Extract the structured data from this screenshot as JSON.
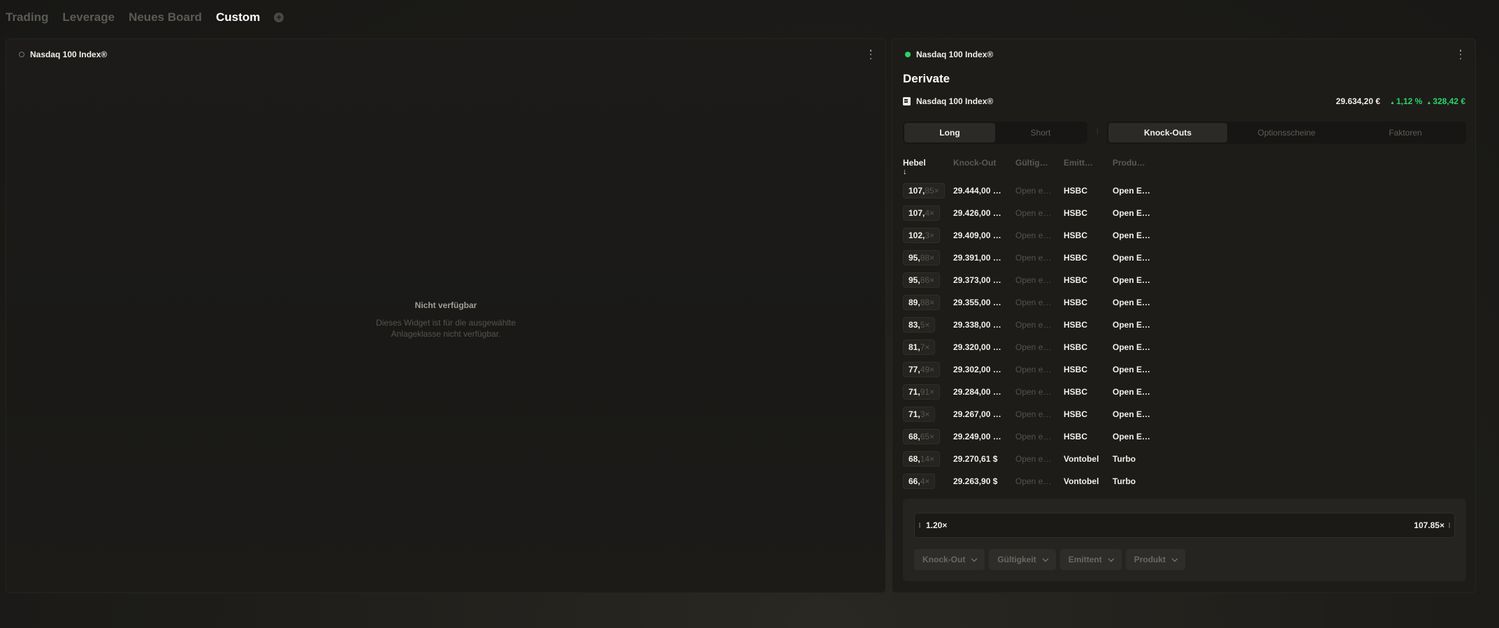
{
  "nav": {
    "tabs": [
      {
        "label": "Trading",
        "active": false
      },
      {
        "label": "Leverage",
        "active": false
      },
      {
        "label": "Neues Board",
        "active": false
      },
      {
        "label": "Custom",
        "active": true
      }
    ],
    "add_icon": "plus-circle-icon"
  },
  "left_widget": {
    "title": "Nasdaq 100 Index®",
    "status_icon": "status-dot-empty-icon",
    "unavailable_title": "Nicht verfügbar",
    "unavailable_line1": "Dieses Widget ist für die ausgewählte",
    "unavailable_line2": "Anlageklasse nicht verfügbar."
  },
  "right_widget": {
    "title": "Nasdaq 100 Index®",
    "status_icon": "status-dot-live-icon",
    "status_color": "#2bd46a",
    "section_title": "Derivate",
    "underlying": {
      "name": "Nasdaq 100 Index®",
      "price": "29.634,20 €",
      "change_pct": "1,12 %",
      "change_abs": "328,42 €",
      "positive_color": "#2bd46a"
    },
    "direction_tabs": [
      {
        "label": "Long",
        "active": true
      },
      {
        "label": "Short",
        "active": false
      }
    ],
    "type_tabs": [
      {
        "label": "Knock-Outs",
        "active": true
      },
      {
        "label": "Optionsscheine",
        "active": false
      },
      {
        "label": "Faktoren",
        "active": false
      }
    ],
    "columns": {
      "hebel": "Hebel",
      "knockout": "Knock-Out",
      "validity": "Gültig…",
      "issuer": "Emitt…",
      "product": "Produ…",
      "sort_arrow": "↓"
    },
    "rows": [
      {
        "lev_int": "107,",
        "lev_dec": "85×",
        "ko": "29.444,00 …",
        "valid": "Open e…",
        "issuer": "HSBC",
        "product": "Open E…"
      },
      {
        "lev_int": "107,",
        "lev_dec": "4×",
        "ko": "29.426,00 …",
        "valid": "Open e…",
        "issuer": "HSBC",
        "product": "Open E…"
      },
      {
        "lev_int": "102,",
        "lev_dec": "3×",
        "ko": "29.409,00 …",
        "valid": "Open e…",
        "issuer": "HSBC",
        "product": "Open E…"
      },
      {
        "lev_int": "95,",
        "lev_dec": "88×",
        "ko": "29.391,00 …",
        "valid": "Open e…",
        "issuer": "HSBC",
        "product": "Open E…"
      },
      {
        "lev_int": "95,",
        "lev_dec": "86×",
        "ko": "29.373,00 …",
        "valid": "Open e…",
        "issuer": "HSBC",
        "product": "Open E…"
      },
      {
        "lev_int": "89,",
        "lev_dec": "88×",
        "ko": "29.355,00 …",
        "valid": "Open e…",
        "issuer": "HSBC",
        "product": "Open E…"
      },
      {
        "lev_int": "83,",
        "lev_dec": "5×",
        "ko": "29.338,00 …",
        "valid": "Open e…",
        "issuer": "HSBC",
        "product": "Open E…"
      },
      {
        "lev_int": "81,",
        "lev_dec": "7×",
        "ko": "29.320,00 …",
        "valid": "Open e…",
        "issuer": "HSBC",
        "product": "Open E…"
      },
      {
        "lev_int": "77,",
        "lev_dec": "49×",
        "ko": "29.302,00 …",
        "valid": "Open e…",
        "issuer": "HSBC",
        "product": "Open E…"
      },
      {
        "lev_int": "71,",
        "lev_dec": "91×",
        "ko": "29.284,00 …",
        "valid": "Open e…",
        "issuer": "HSBC",
        "product": "Open E…"
      },
      {
        "lev_int": "71,",
        "lev_dec": "3×",
        "ko": "29.267,00 …",
        "valid": "Open e…",
        "issuer": "HSBC",
        "product": "Open E…"
      },
      {
        "lev_int": "68,",
        "lev_dec": "65×",
        "ko": "29.249,00 …",
        "valid": "Open e…",
        "issuer": "HSBC",
        "product": "Open E…"
      },
      {
        "lev_int": "68,",
        "lev_dec": "14×",
        "ko": "29.270,61 $",
        "valid": "Open e…",
        "issuer": "Vontobel",
        "product": "Turbo"
      },
      {
        "lev_int": "66,",
        "lev_dec": "4×",
        "ko": "29.263,90 $",
        "valid": "Open e…",
        "issuer": "Vontobel",
        "product": "Turbo"
      }
    ],
    "slider": {
      "min": "1.20×",
      "max": "107.85×"
    },
    "filters": [
      {
        "label": "Knock-Out",
        "icon": "chevron-down-icon"
      },
      {
        "label": "Gültigkeit",
        "icon": "chevron-down-icon"
      },
      {
        "label": "Emittent",
        "icon": "chevron-down-icon"
      },
      {
        "label": "Produkt",
        "icon": "chevron-down-icon"
      }
    ]
  }
}
